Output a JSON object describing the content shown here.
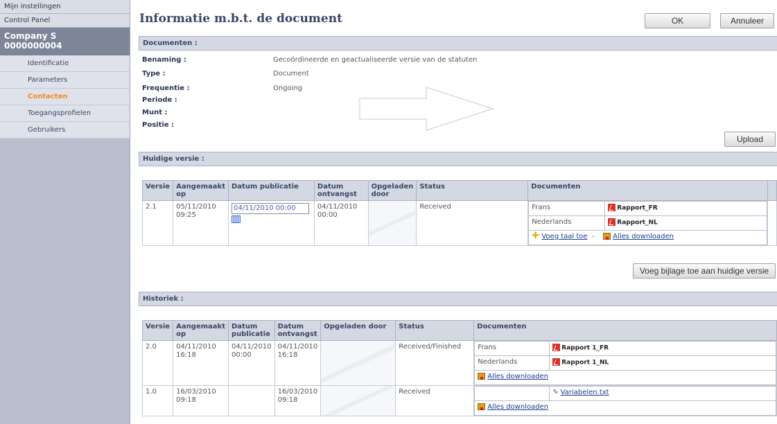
{
  "sidebar": {
    "items_top": [
      "Mijn instellingen",
      "Control Panel"
    ],
    "company_name": "Company S",
    "company_id": "0000000004",
    "nav": [
      {
        "label": "Identificatie",
        "active": false
      },
      {
        "label": "Parameters",
        "active": false
      },
      {
        "label": "Contacten",
        "active": true
      },
      {
        "label": "Toegangsprofielen",
        "active": false
      },
      {
        "label": "Gebruikers",
        "active": false
      }
    ]
  },
  "header": {
    "title": "Informatie m.b.t. de document",
    "ok_label": "OK",
    "cancel_label": "Annuleer"
  },
  "documenten": {
    "section_title": "Documenten :",
    "fields": [
      {
        "label": "Benaming :",
        "value": "Gecoördineerde en geactualiseerde versie van de statuten"
      },
      {
        "label": "Type :",
        "value": "Document"
      },
      {
        "label": "Frequentie :",
        "value": "Ongoing"
      },
      {
        "label": "Periode :",
        "value": ""
      },
      {
        "label": "Munt :",
        "value": ""
      },
      {
        "label": "Positie :",
        "value": ""
      }
    ],
    "upload_label": "Upload"
  },
  "huidige": {
    "section_title": "Huidige versie :",
    "columns": [
      "Versie",
      "Aangemaakt op",
      "Datum publicatie",
      "Datum ontvangst",
      "Opgeladen door",
      "Status",
      "Documenten"
    ],
    "row": {
      "versie": "2.1",
      "aangemaakt": "05/11/2010 09:25",
      "publicatie": "04/11/2010 00:00",
      "ontvangst": "04/11/2010 00:00",
      "opgeladen": "",
      "status": "Received",
      "docs": [
        {
          "lang": "Frans",
          "file": "Rapport_FR"
        },
        {
          "lang": "Nederlands",
          "file": "Rapport_NL"
        }
      ],
      "add_lang_label": "Voeg taal toe",
      "separator": "-",
      "download_all_label": "Alles downloaden"
    },
    "attach_label": "Voeg bijlage toe aan huidige versie"
  },
  "historiek": {
    "section_title": "Historiek :",
    "columns": [
      "Versie",
      "Aangemaakt op",
      "Datum publicatie",
      "Datum ontvangst",
      "Opgeladen door",
      "Status",
      "Documenten"
    ],
    "rows": [
      {
        "versie": "2.0",
        "aangemaakt": "04/11/2010 16:18",
        "publicatie": "04/11/2010 00:00",
        "ontvangst": "04/11/2010 16:18",
        "status": "Received/Finished",
        "docs": [
          {
            "lang": "Frans",
            "file": "Rapport 1_FR"
          },
          {
            "lang": "Nederlands",
            "file": "Rapport 1_NL"
          }
        ],
        "download_all_label": "Alles downloaden"
      },
      {
        "versie": "1.0",
        "aangemaakt": "16/03/2010 09:18",
        "publicatie": "",
        "ontvangst": "16/03/2010 09:18",
        "status": "Received",
        "attachment": "Variabelen.txt",
        "download_all_label": "Alles downloaden"
      }
    ]
  },
  "icons": {
    "pdf": "pdf-icon",
    "calendar": "calendar-icon",
    "add": "plus-icon",
    "download": "download-icon",
    "attachment": "paperclip-icon"
  },
  "colors": {
    "accent_active": "#f08a1c",
    "header_bar": "#d4d8e2",
    "title": "#3a4666"
  }
}
